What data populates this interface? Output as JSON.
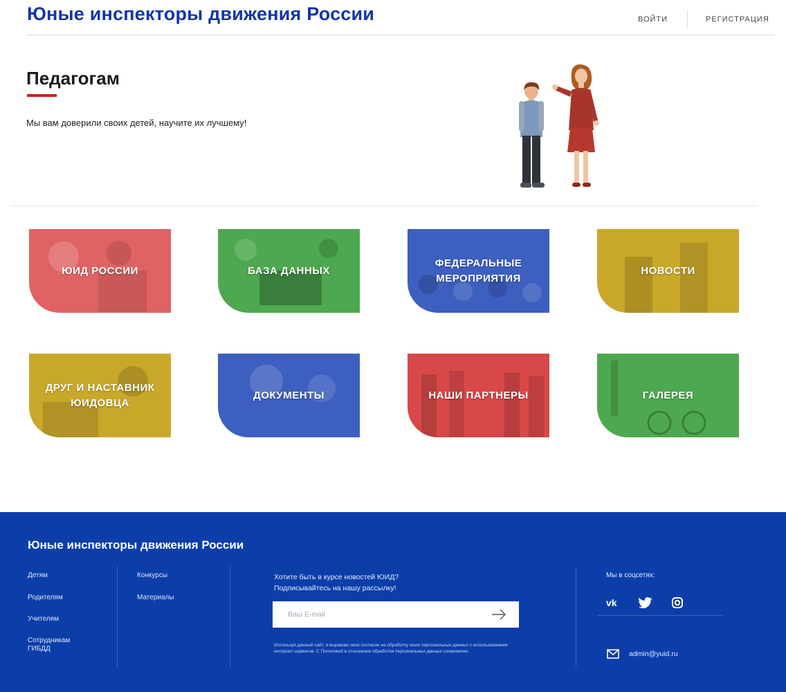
{
  "header": {
    "site_title": "Юные инспекторы движения России",
    "login": "ВОЙТИ",
    "register": "РЕГИСТРАЦИЯ"
  },
  "hero": {
    "title": "Педагогам",
    "subtitle": "Мы вам доверили своих детей, научите их лучшему!"
  },
  "tiles": [
    {
      "label": "ЮИД РОССИИ",
      "color": "#e06363"
    },
    {
      "label": "БАЗА ДАННЫХ",
      "color": "#4ea84f"
    },
    {
      "label": "ФЕДЕРАЛЬНЫЕ МЕРОПРИЯТИЯ",
      "color": "#3d5fbf"
    },
    {
      "label": "НОВОСТИ",
      "color": "#c9a829"
    },
    {
      "label": "ДРУГ И НАСТАВНИК ЮИДОВЦА",
      "color": "#c9a829"
    },
    {
      "label": "ДОКУМЕНТЫ",
      "color": "#3d5fbf"
    },
    {
      "label": "НАШИ ПАРТНЕРЫ",
      "color": "#d94848"
    },
    {
      "label": "ГАЛЕРЕЯ",
      "color": "#4ea84f"
    }
  ],
  "footer": {
    "title": "Юные инспекторы движения России",
    "col1": [
      "Детям",
      "Родителям",
      "Учителям",
      "Сотрудникам ГИБДД"
    ],
    "col2": [
      "Конкурсы",
      "Материалы"
    ],
    "subscribe_line1": "Хотите быть в курсе новостей ЮИД?",
    "subscribe_line2": "Подписывайтесь на нашу рассылку!",
    "email_placeholder": "Ваш E-mail",
    "consent": "Используя данный сайт, я выражаю свое согласие на обработку моих персональных данных с использованием интернет-сервисов. С Политикой в отношении обработки персональных данных ознакомлен.",
    "social_title": "Мы в соцсетях:",
    "social_icons": [
      "vk-icon",
      "twitter-icon",
      "instagram-icon"
    ],
    "contact_email": "admin@yuid.ru",
    "bg_color": "#0c3eaa"
  }
}
